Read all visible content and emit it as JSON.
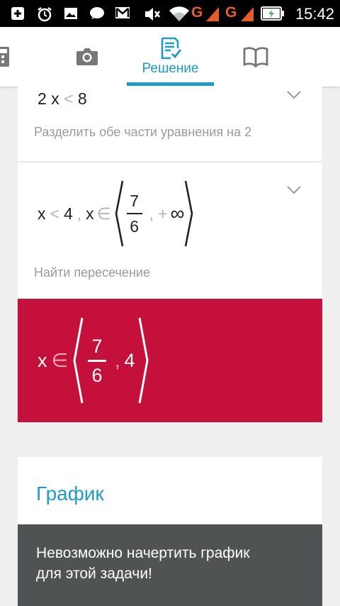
{
  "status_bar": {
    "time": "15:42",
    "network_label_1": "G",
    "network_label_2": "G",
    "icons": [
      "add-icon",
      "alarm-icon",
      "image-icon",
      "chat-icon",
      "gmail-icon",
      "mute-icon",
      "wifi-icon",
      "signal-icon",
      "battery-charging-icon"
    ]
  },
  "tabs": {
    "icons": [
      "calculator-icon",
      "camera-icon",
      "solution-icon",
      "book-icon"
    ],
    "active_label": "Решение",
    "accent_color": "#1e9bc6"
  },
  "steps": [
    {
      "expression": {
        "lhs": "2 x",
        "op": "<",
        "rhs": "8"
      },
      "description": "Разделить обе части уравнения на 2"
    },
    {
      "expression": {
        "lhs": "x",
        "op1": "<",
        "val": "4",
        "sep": ",",
        "var": "x",
        "in": "∈",
        "frac_num": "7",
        "frac_den": "6",
        "comma": ",",
        "plus": "+",
        "inf": "∞"
      },
      "description": "Найти пересечение"
    }
  ],
  "result": {
    "var": "x",
    "in": "∈",
    "frac_num": "7",
    "frac_den": "6",
    "comma": ",",
    "upper": "4",
    "color": "#c4103a"
  },
  "graph": {
    "title": "График",
    "message": "Невозможно начертить график\nдля этой задачи!"
  }
}
